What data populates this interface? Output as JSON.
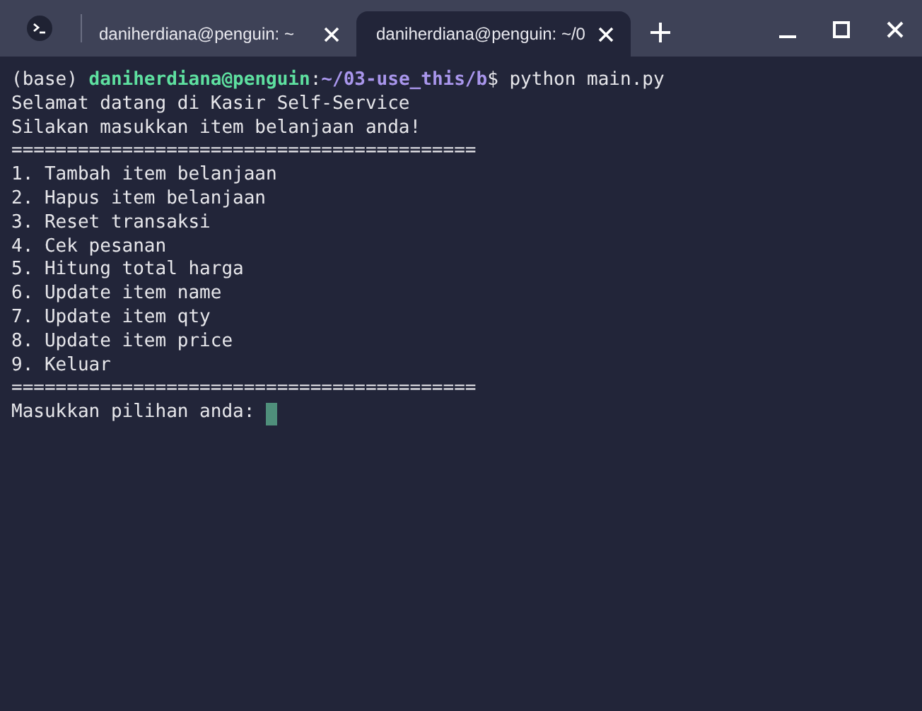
{
  "tabs": [
    {
      "title": "daniherdiana@penguin: ~",
      "selected": false
    },
    {
      "title": "daniherdiana@penguin: ~/0",
      "selected": true
    }
  ],
  "terminal": {
    "lines": [
      {
        "segments": [
          {
            "text": "(base) ",
            "kind": "plain"
          },
          {
            "text": "daniherdiana@penguin",
            "kind": "user"
          },
          {
            "text": ":",
            "kind": "plain"
          },
          {
            "text": "~/03-use_this/b",
            "kind": "path"
          },
          {
            "text": "$ python main.py",
            "kind": "plain"
          }
        ]
      },
      {
        "segments": [
          {
            "text": "Selamat datang di Kasir Self-Service",
            "kind": "plain"
          }
        ]
      },
      {
        "segments": [
          {
            "text": "Silakan masukkan item belanjaan anda!",
            "kind": "plain"
          }
        ]
      },
      {
        "segments": [
          {
            "text": "==========================================",
            "kind": "plain"
          }
        ]
      },
      {
        "segments": [
          {
            "text": "1. Tambah item belanjaan",
            "kind": "plain"
          }
        ]
      },
      {
        "segments": [
          {
            "text": "2. Hapus item belanjaan",
            "kind": "plain"
          }
        ]
      },
      {
        "segments": [
          {
            "text": "3. Reset transaksi",
            "kind": "plain"
          }
        ]
      },
      {
        "segments": [
          {
            "text": "4. Cek pesanan",
            "kind": "plain"
          }
        ]
      },
      {
        "segments": [
          {
            "text": "5. Hitung total harga",
            "kind": "plain"
          }
        ]
      },
      {
        "segments": [
          {
            "text": "6. Update item name",
            "kind": "plain"
          }
        ]
      },
      {
        "segments": [
          {
            "text": "7. Update item qty",
            "kind": "plain"
          }
        ]
      },
      {
        "segments": [
          {
            "text": "8. Update item price",
            "kind": "plain"
          }
        ]
      },
      {
        "segments": [
          {
            "text": "9. Keluar",
            "kind": "plain"
          }
        ]
      },
      {
        "segments": [
          {
            "text": "==========================================",
            "kind": "plain"
          }
        ]
      },
      {
        "segments": [
          {
            "text": "Masukkan pilihan anda: ",
            "kind": "plain"
          }
        ],
        "cursor": true
      }
    ]
  }
}
